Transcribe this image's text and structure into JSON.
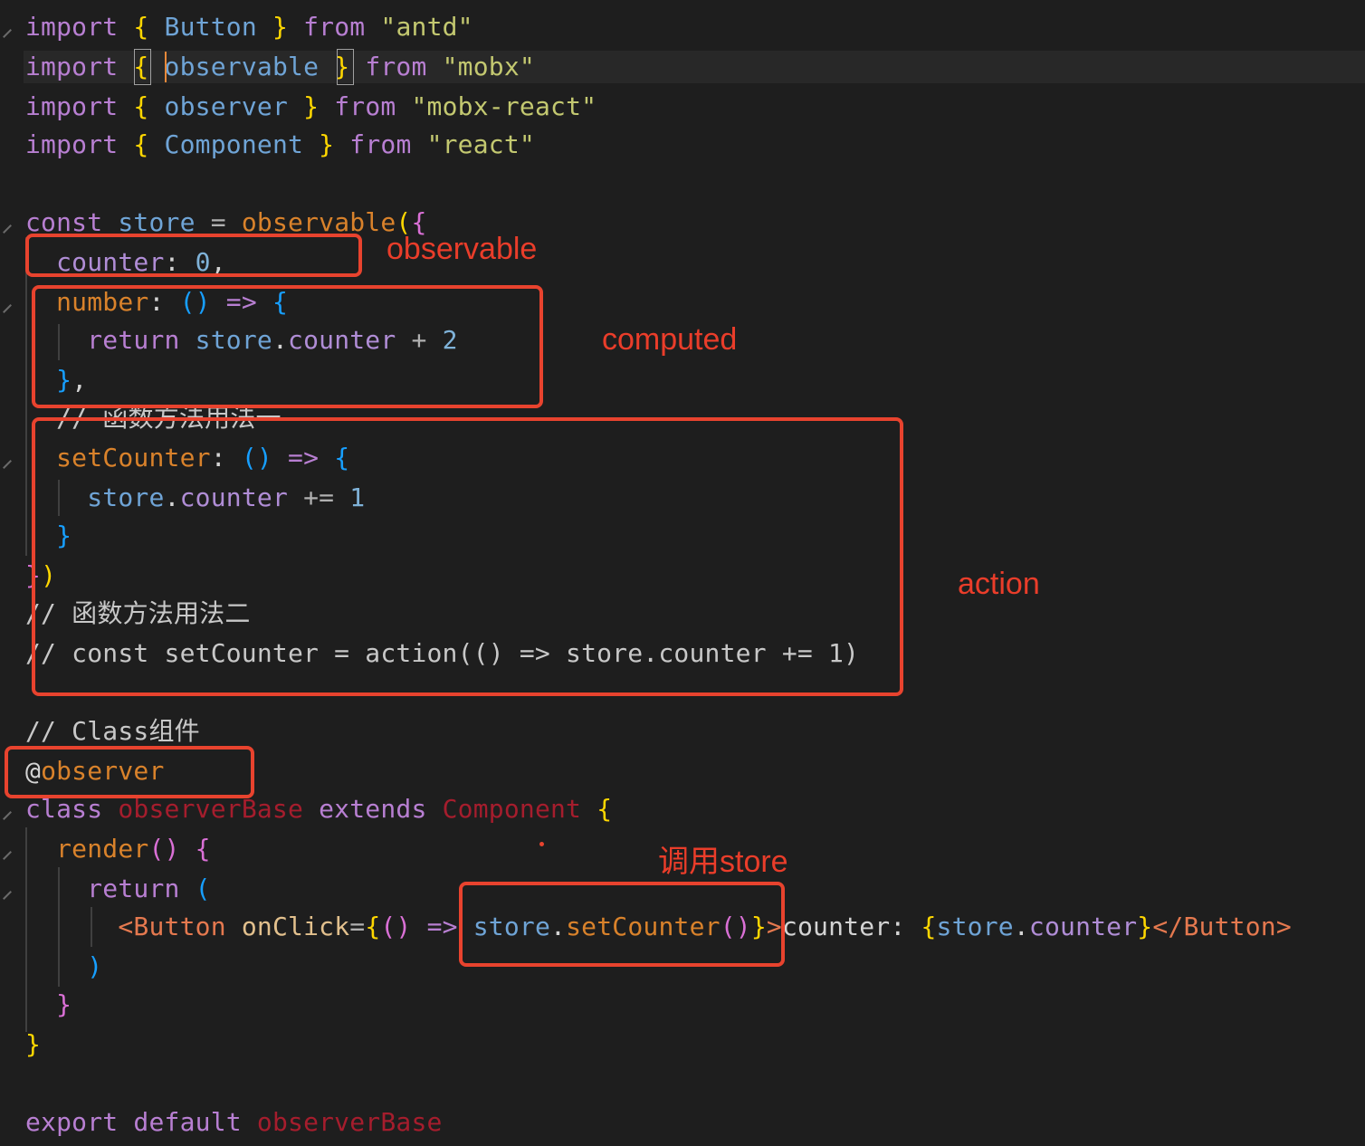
{
  "editor": {
    "theme_colors": {
      "background": "#1e1e1e",
      "annotation": "#e8432e"
    },
    "lines": {
      "l1": {
        "a": "import",
        "b": "{",
        "c": "Button",
        "d": "}",
        "e": "from",
        "f": "\"antd\""
      },
      "l2": {
        "a": "import",
        "b": "{",
        "c": "observable",
        "d": "}",
        "e": "from",
        "f": "\"mobx\""
      },
      "l3": {
        "a": "import",
        "b": "{",
        "c": "observer",
        "d": "}",
        "e": "from",
        "f": "\"mobx-react\""
      },
      "l4": {
        "a": "import",
        "b": "{",
        "c": "Component",
        "d": "}",
        "e": "from",
        "f": "\"react\""
      },
      "l6": {
        "a": "const",
        "b": "store",
        "c": "=",
        "d": "observable",
        "e": "(",
        "f": "{"
      },
      "l7": {
        "a": "counter",
        "b": ":",
        "c": "0",
        "d": ","
      },
      "l8": {
        "a": "number",
        "b": ":",
        "c": "()",
        "d": "=>",
        "e": "{"
      },
      "l9": {
        "a": "return",
        "b": "store",
        "c": ".",
        "d": "counter",
        "e": "+",
        "f": "2"
      },
      "l10": {
        "a": "}",
        "b": ","
      },
      "l11": {
        "a": "// 函数方法用法一"
      },
      "l12": {
        "a": "setCounter",
        "b": ":",
        "c": "()",
        "d": "=>",
        "e": "{"
      },
      "l13": {
        "a": "store",
        "b": ".",
        "c": "counter",
        "d": "+=",
        "e": "1"
      },
      "l14": {
        "a": "}"
      },
      "l15": {
        "a": "}",
        "b": ")"
      },
      "l16": {
        "a": "// 函数方法用法二"
      },
      "l17": {
        "a": "// const setCounter = action(() => store.counter += 1)"
      },
      "l19": {
        "a": "// Class组件"
      },
      "l20": {
        "a": "@",
        "b": "observer"
      },
      "l21": {
        "a": "class",
        "b": "observerBase",
        "c": "extends",
        "d": "Component",
        "e": "{"
      },
      "l22": {
        "a": "render",
        "b": "()",
        "c": "{"
      },
      "l23": {
        "a": "return",
        "b": "("
      },
      "l24": {
        "a": "<",
        "b": "Button",
        "c": "onClick",
        "d": "=",
        "e": "{",
        "f": "()",
        "g": "=>",
        "h": "store",
        "i": ".",
        "j": "setCounter",
        "k": "()",
        "l": "}",
        "m": ">",
        "n": "counter: ",
        "o": "{",
        "p": "store",
        "q": ".",
        "r": "counter",
        "s": "}",
        "t": "</",
        "u": "Button",
        "v": ">"
      },
      "l25": {
        "a": ")"
      },
      "l26": {
        "a": "}"
      },
      "l27": {
        "a": "}"
      },
      "l29": {
        "a": "export",
        "b": "default",
        "c": "observerBase"
      }
    }
  },
  "annotations": {
    "observable_label": "observable",
    "computed_label": "computed",
    "action_label": "action",
    "call_store_label": "调用store"
  }
}
